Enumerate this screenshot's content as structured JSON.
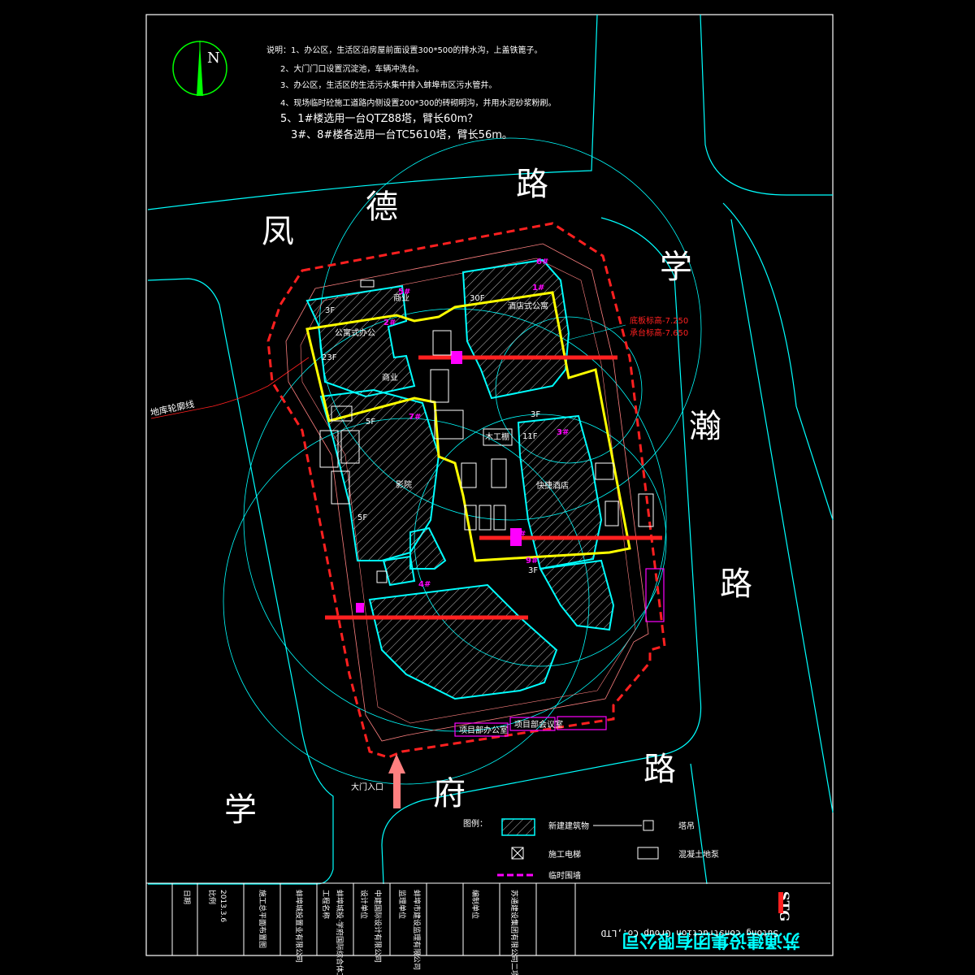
{
  "notes": {
    "l1": "说明：1、办公区，生活区沿房屋前面设置300*500的排水沟，上盖铁篦子。",
    "l2": "2、大门门口设置沉淀池，车辆冲洗台。",
    "l3": "3、办公区，生活区的生活污水集中排入蚌埠市区污水管井。",
    "l4": "4、现场临时砼施工道路内侧设置200*300的砖砌明沟，并用水泥砂浆粉刷。",
    "l5": "5、1#楼选用一台QTZ88塔，臂长60m？",
    "l6": "3#、8#楼各选用一台TC5610塔，臂长56m。"
  },
  "compass": {
    "north": "N"
  },
  "roads": {
    "top": [
      "凤",
      "德",
      "路"
    ],
    "right": [
      "学",
      "瀚",
      "路"
    ],
    "bottom": [
      "学",
      "府",
      "路"
    ]
  },
  "labels": {
    "basement_line": "地库轮廓线",
    "gate": "大门入口",
    "r1": "底板标高-7.250",
    "r2": "承台标高-7.650",
    "apartment": "酒店式公寓",
    "office": "公寓式办公",
    "commerce1": "商业",
    "commerce2": "商业",
    "cinema": "影院",
    "hotel": "快捷酒店",
    "f30": "30F",
    "f23": "23F",
    "f11": "11F",
    "f5a": "5F",
    "f5b": "5F",
    "f3a": "3F",
    "f3b": "3F",
    "f3c": "3F",
    "b1": "1#",
    "b2": "2#",
    "b3": "3#",
    "b4": "4#",
    "b5": "5#",
    "b6": "6#",
    "b7": "7#",
    "b8": "8#",
    "b9": "9#",
    "site_office": "项目部办公室",
    "site_meeting": "项目部会议室",
    "woodwork": "木工棚",
    "woodwork2": "木工棚"
  },
  "legend": {
    "title": "图例：",
    "item1": "新建建筑物",
    "item2": "塔吊",
    "item3": "施工电梯",
    "item4": "混凝土地泵",
    "item5": "临时围墙"
  },
  "titleblock": {
    "company": "苏通建设集团有限公司",
    "company_en": "Sutong construction Group  Co.,LTD",
    "logo": "STG",
    "date": "2013.3.6",
    "c1": "日期",
    "c2": "比例",
    "c3": "施工总平面布置图",
    "c4": "蚌埠城投置业有限公司",
    "c5": "工程名称",
    "c6": "蚌埠城投·学府国际综合体工程",
    "c7": "设计单位",
    "c8": "中建国际设计有限公司",
    "c9": "监理单位",
    "c10": "蚌埠市建设监理有限公司",
    "c11": "编制单位",
    "c12": "苏通建设集团有限公司二项目部"
  },
  "colors": {
    "cyan": "#00ffff",
    "red": "#ff2020",
    "yellow": "#ffff00",
    "magenta": "#ff00ff",
    "green": "#00ff00",
    "salmon": "#ff8080",
    "white": "#ffffff"
  }
}
